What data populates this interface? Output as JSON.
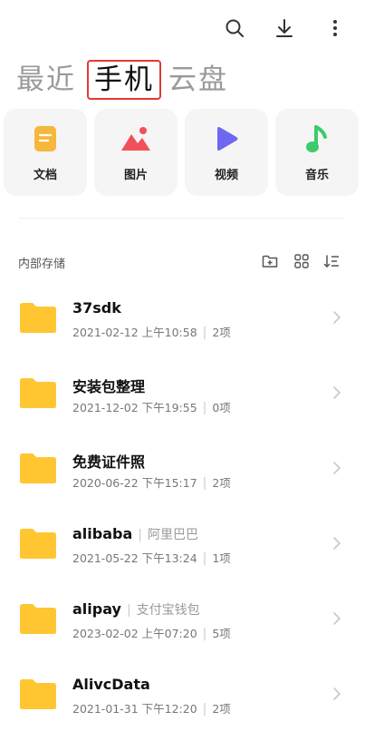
{
  "tabs": {
    "recent": "最近",
    "phone": "手机",
    "cloud": "云盘"
  },
  "categories": [
    {
      "label": "文档",
      "icon": "document-icon",
      "color": "#F6B73C"
    },
    {
      "label": "图片",
      "icon": "image-icon",
      "color": "#F0505A"
    },
    {
      "label": "视频",
      "icon": "video-icon",
      "color": "#6E67F2"
    },
    {
      "label": "音乐",
      "icon": "music-icon",
      "color": "#3CCB6A"
    }
  ],
  "section": {
    "title": "内部存储"
  },
  "files": [
    {
      "name": "37sdk",
      "sub": "",
      "date": "2021-02-12 上午10:58",
      "count": "2项"
    },
    {
      "name": "安装包整理",
      "sub": "",
      "date": "2021-12-02 下午19:55",
      "count": "0项"
    },
    {
      "name": "免费证件照",
      "sub": "",
      "date": "2020-06-22 下午15:17",
      "count": "2项"
    },
    {
      "name": "alibaba",
      "sub": "阿里巴巴",
      "date": "2021-05-22 下午13:24",
      "count": "1项"
    },
    {
      "name": "alipay",
      "sub": "支付宝钱包",
      "date": "2023-02-02 上午07:20",
      "count": "5项"
    },
    {
      "name": "AlivcData",
      "sub": "",
      "date": "2021-01-31 下午12:20",
      "count": "2项"
    }
  ],
  "colors": {
    "folder": "#FFC632",
    "active_border": "#E53935"
  }
}
